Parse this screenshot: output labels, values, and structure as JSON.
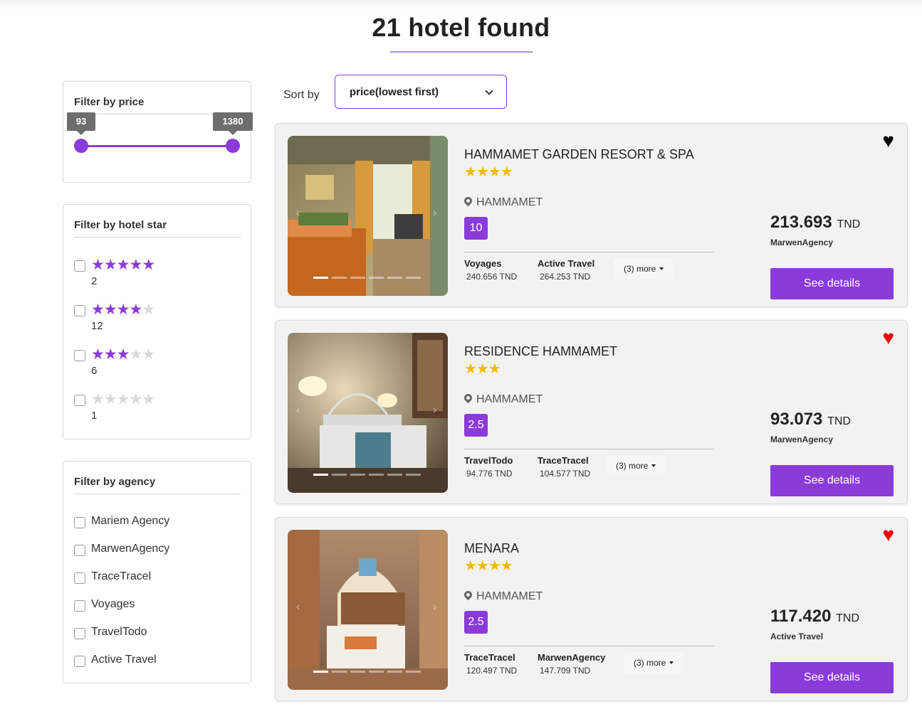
{
  "page_title": "21 hotel found",
  "filters": {
    "price": {
      "title": "Filter by price",
      "min": "93",
      "max": "1380"
    },
    "stars": {
      "title": "Filter by hotel star",
      "options": [
        {
          "stars": 5,
          "count": "2"
        },
        {
          "stars": 4,
          "count": "12"
        },
        {
          "stars": 3,
          "count": "6"
        },
        {
          "stars": 0,
          "count": "1"
        }
      ]
    },
    "agency": {
      "title": "Filter by agency",
      "options": [
        "Mariem Agency",
        "MarwenAgency",
        "TraceTracel",
        "Voyages",
        "TravelTodo",
        "Active Travel"
      ]
    }
  },
  "sort": {
    "label": "Sort by",
    "value": "price(lowest first)"
  },
  "hotels": [
    {
      "name": "HAMMAMET GARDEN RESORT & SPA",
      "stars": 4,
      "stars_text": "★★★★",
      "location": "HAMMAMET",
      "rating": "10",
      "offers": [
        {
          "agency": "Voyages",
          "price": "240.656 TND"
        },
        {
          "agency": "Active Travel",
          "price": "264.253 TND"
        }
      ],
      "more": "(3) more",
      "price": "213.693",
      "currency": "TND",
      "best_agency": "MarwenAgency",
      "favorite": true,
      "heart_color": "#000000",
      "button": "See details"
    },
    {
      "name": "RESIDENCE HAMMAMET",
      "stars": 3,
      "stars_text": "★★★",
      "location": "HAMMAMET",
      "rating": "2.5",
      "offers": [
        {
          "agency": "TravelTodo",
          "price": "94.776 TND"
        },
        {
          "agency": "TraceTracel",
          "price": "104.577 TND"
        }
      ],
      "more": "(3) more",
      "price": "93.073",
      "currency": "TND",
      "best_agency": "MarwenAgency",
      "favorite": true,
      "heart_color": "#ee0000",
      "button": "See details"
    },
    {
      "name": "MENARA",
      "stars": 4,
      "stars_text": "★★★★",
      "location": "HAMMAMET",
      "rating": "2.5",
      "offers": [
        {
          "agency": "TraceTracel",
          "price": "120.497 TND"
        },
        {
          "agency": "MarwenAgency",
          "price": "147.709 TND"
        }
      ],
      "more": "(3) more",
      "price": "117.420",
      "currency": "TND",
      "best_agency": "Active Travel",
      "favorite": true,
      "heart_color": "#ee0000",
      "button": "See details"
    }
  ],
  "colors": {
    "accent": "#8b3bd9",
    "hotel_star": "#f5b800",
    "card_bg": "#f2f2f2"
  }
}
